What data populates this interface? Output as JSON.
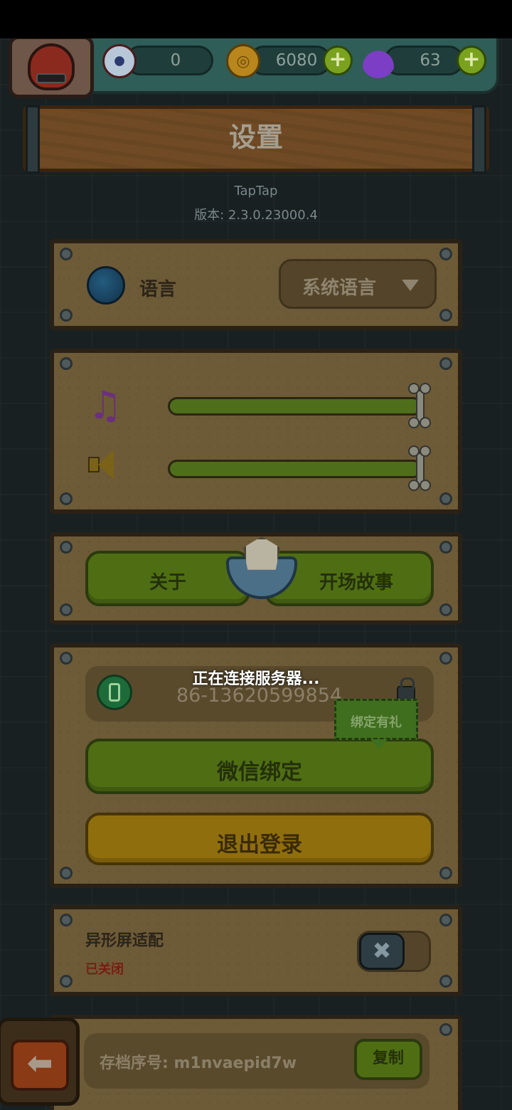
{
  "resources": {
    "eyes": "0",
    "coins": "6080",
    "potions": "63",
    "plus_symbol": "+"
  },
  "header": {
    "title": "设置",
    "channel": "TapTap",
    "version": "版本: 2.3.0.23000.4"
  },
  "language": {
    "label": "语言",
    "selected": "系统语言"
  },
  "audio": {
    "music_volume": 1.0,
    "sound_volume": 1.0
  },
  "buttons": {
    "about": "关于",
    "opening_story": "开场故事",
    "wechat_bind": "微信绑定",
    "logout": "退出登录",
    "copy": "复制",
    "toggle_x": "✖"
  },
  "account": {
    "phone": "86-13620599854",
    "bind_gift": "绑定有礼"
  },
  "notch": {
    "label": "异形屏适配",
    "status": "已关闭",
    "enabled": false
  },
  "save": {
    "id_text": "存档序号: m1nvaepid7w"
  },
  "loading": {
    "message": "正在连接服务器..."
  },
  "icons": {
    "back_glyph": "⬅",
    "music_glyph": "♫",
    "coin_glyph": "◎"
  },
  "colors": {
    "background": "#182022",
    "panel": "#6d5a37",
    "button_green": "#4f6e14",
    "button_yellow": "#8f6e0e",
    "status_off": "#7a1c12"
  }
}
